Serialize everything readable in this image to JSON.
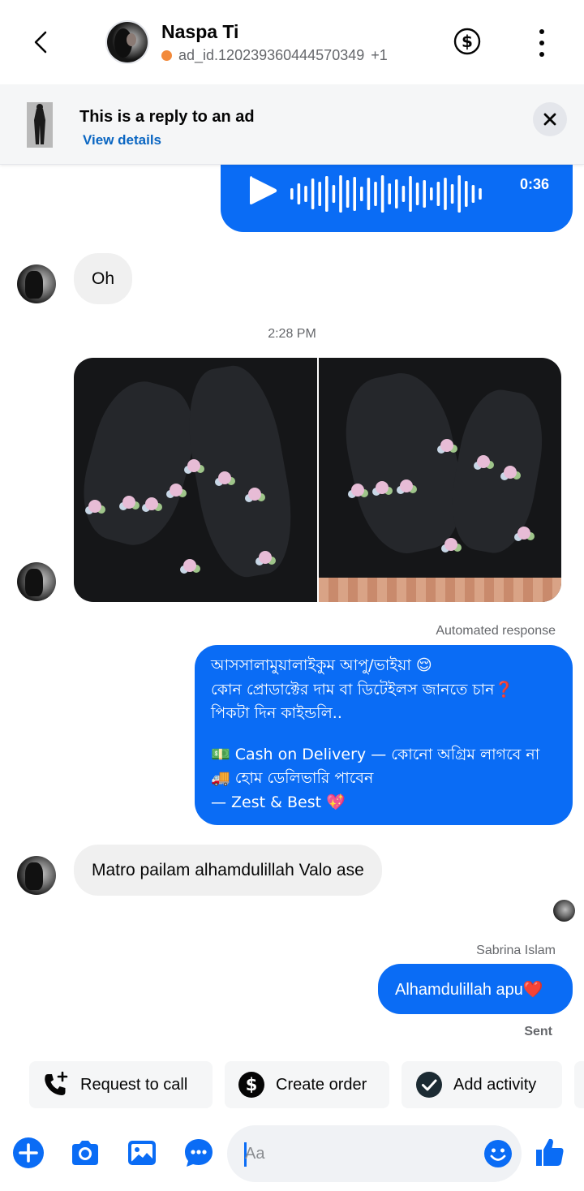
{
  "header": {
    "contact_name": "Naspa Ti",
    "ad_id_text": "ad_id.120239360444570349",
    "ad_id_extra": "+1",
    "status_color": "#f28a3b"
  },
  "ad_banner": {
    "title": "This is a reply to an ad",
    "link": "View details"
  },
  "messages": {
    "audio_duration": "0:36",
    "msg_oh": "Oh",
    "timestamp": "2:28 PM",
    "automated_label": "Automated response",
    "auto_lines": [
      "আসসালামুয়ালাইকুম আপু/ভাইয়া 😌",
      "কোন প্রোডাক্টের দাম বা ডিটেইলস জানতে চান❓",
      "পিকটা দিন কাইন্ডলি..",
      "💵 Cash on Delivery — কোনো অগ্রিম লাগবে না",
      "🚚 হোম ডেলিভারি পাবেন",
      "— Zest & Best 💖"
    ],
    "msg_matro": "Matro pailam alhamdulillah Valo ase",
    "sender_name": "Sabrina Islam",
    "msg_reply": "Alhamdulillah apu❤️",
    "sent_label": "Sent"
  },
  "quick_actions": {
    "request_call": "Request to call",
    "create_order": "Create order",
    "add_activity": "Add activity"
  },
  "composer": {
    "placeholder": "Aa"
  },
  "colors": {
    "accent": "#0a6cf5",
    "link": "#0a66c2",
    "incoming_bubble": "#f0f0f0"
  }
}
